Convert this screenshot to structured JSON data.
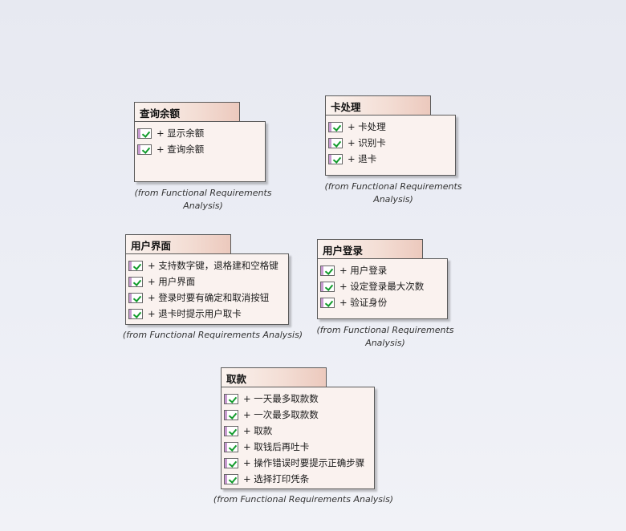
{
  "packages": [
    {
      "name": "查询余额",
      "items": [
        "+ 显示余额",
        "+ 查询余额"
      ],
      "from": [
        "(from Functional Requirements",
        "Analysis)"
      ]
    },
    {
      "name": "卡处理",
      "items": [
        "+ 卡处理",
        "+ 识别卡",
        "+ 退卡"
      ],
      "from": [
        "(from Functional Requirements",
        "Analysis)"
      ]
    },
    {
      "name": "用户界面",
      "items": [
        "+ 支持数字键，退格建和空格键",
        "+ 用户界面",
        "+ 登录时要有确定和取消按钮",
        "+ 退卡时提示用户取卡"
      ],
      "from": [
        "(from Functional Requirements Analysis)"
      ]
    },
    {
      "name": "用户登录",
      "items": [
        "+ 用户登录",
        "+ 设定登录最大次数",
        "+ 验证身份"
      ],
      "from": [
        "(from Functional Requirements",
        "Analysis)"
      ]
    },
    {
      "name": "取款",
      "items": [
        "+ 一天最多取款数",
        "+ 一次最多取款数",
        "+ 取款",
        "+ 取钱后再吐卡",
        "+ 操作错误时要提示正确步骤",
        "+ 选择打印凭条"
      ],
      "from": [
        "(from Functional Requirements Analysis)"
      ]
    }
  ]
}
